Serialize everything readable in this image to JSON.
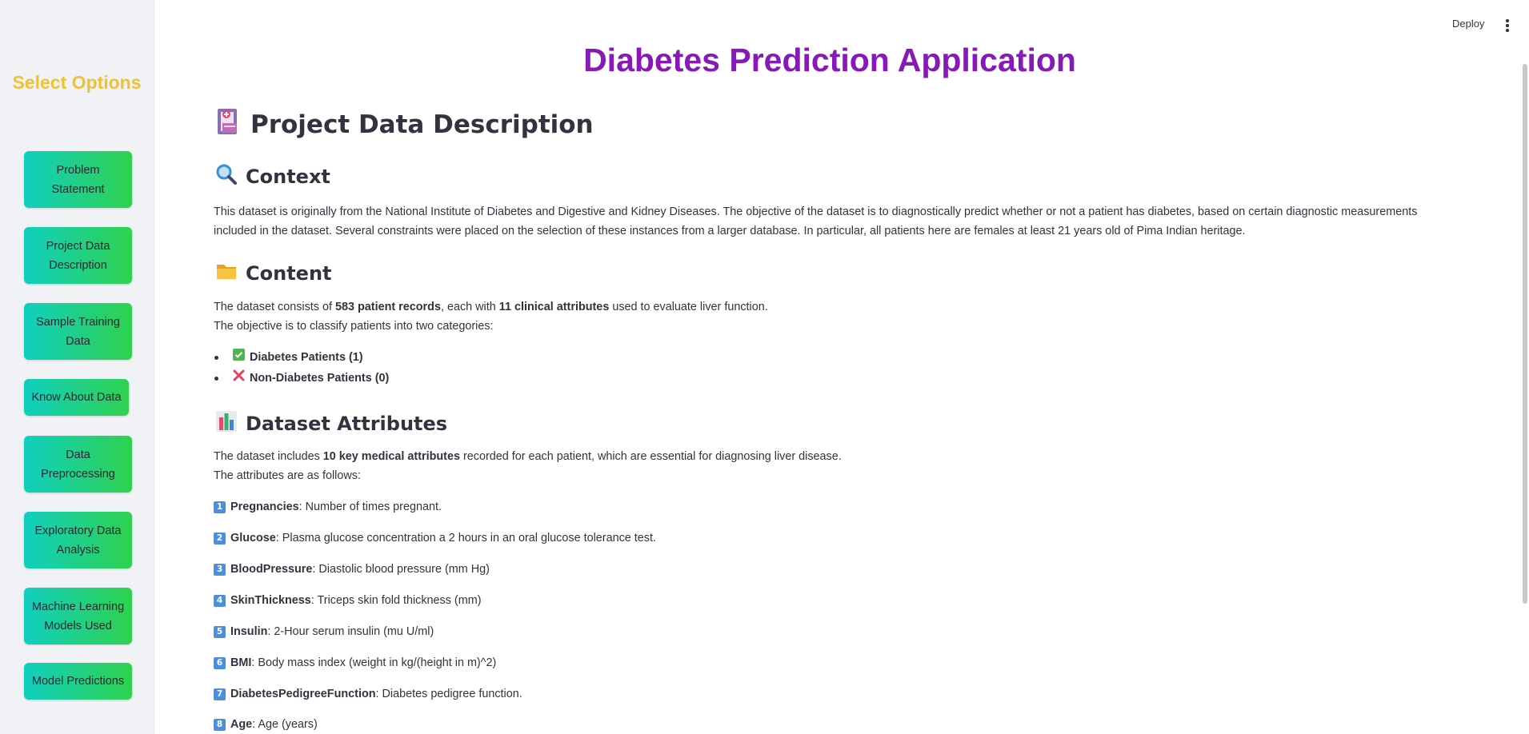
{
  "sidebar": {
    "title": "Select Options",
    "items": [
      {
        "label": "Problem Statement"
      },
      {
        "label": "Project Data Description"
      },
      {
        "label": "Sample Training Data"
      },
      {
        "label": "Know About Data"
      },
      {
        "label": "Data Preprocessing"
      },
      {
        "label": "Exploratory Data Analysis"
      },
      {
        "label": "Machine Learning Models Used"
      },
      {
        "label": "Model Predictions"
      }
    ]
  },
  "header": {
    "deploy_label": "Deploy",
    "menu_icon": "kebab-menu-icon"
  },
  "main": {
    "app_title": "Diabetes Prediction Application",
    "section_title": "Project Data Description",
    "section_icon": "medical-record-icon",
    "context": {
      "heading": "Context",
      "icon": "magnifier-icon",
      "text": "This dataset is originally from the National Institute of Diabetes and Digestive and Kidney Diseases. The objective of the dataset is to diagnostically predict whether or not a patient has diabetes, based on certain diagnostic measurements included in the dataset. Several constraints were placed on the selection of these instances from a larger database. In particular, all patients here are females at least 21 years old of Pima Indian heritage."
    },
    "content": {
      "heading": "Content",
      "icon": "folder-icon",
      "line1_pre": "The dataset consists of ",
      "line1_bold1": "583 patient records",
      "line1_mid": ", each with ",
      "line1_bold2": "11 clinical attributes",
      "line1_post": " used to evaluate liver function.",
      "line2": "The objective is to classify patients into two categories:",
      "bullets": [
        {
          "icon": "check-icon",
          "label": "Diabetes Patients (1)"
        },
        {
          "icon": "cross-icon",
          "label": "Non-Diabetes Patients (0)"
        }
      ]
    },
    "attributes": {
      "heading": "Dataset Attributes",
      "icon": "bar-chart-icon",
      "line1_pre": "The dataset includes ",
      "line1_bold": "10 key medical attributes",
      "line1_post": " recorded for each patient, which are essential for diagnosing liver disease.",
      "line2": "The attributes are as follows:",
      "items": [
        {
          "num": "1",
          "name": "Pregnancies",
          "desc": ": Number of times pregnant."
        },
        {
          "num": "2",
          "name": "Glucose",
          "desc": ": Plasma glucose concentration a 2 hours in an oral glucose tolerance test."
        },
        {
          "num": "3",
          "name": "BloodPressure",
          "desc": ": Diastolic blood pressure (mm Hg)"
        },
        {
          "num": "4",
          "name": "SkinThickness",
          "desc": ": Triceps skin fold thickness (mm)"
        },
        {
          "num": "5",
          "name": "Insulin",
          "desc": ": 2-Hour serum insulin (mu U/ml)"
        },
        {
          "num": "6",
          "name": "BMI",
          "desc": ": Body mass index (weight in kg/(height in m)^2)"
        },
        {
          "num": "7",
          "name": "DiabetesPedigreeFunction",
          "desc": ": Diabetes pedigree function."
        },
        {
          "num": "8",
          "name": "Age",
          "desc": ": Age (years)"
        }
      ]
    }
  }
}
